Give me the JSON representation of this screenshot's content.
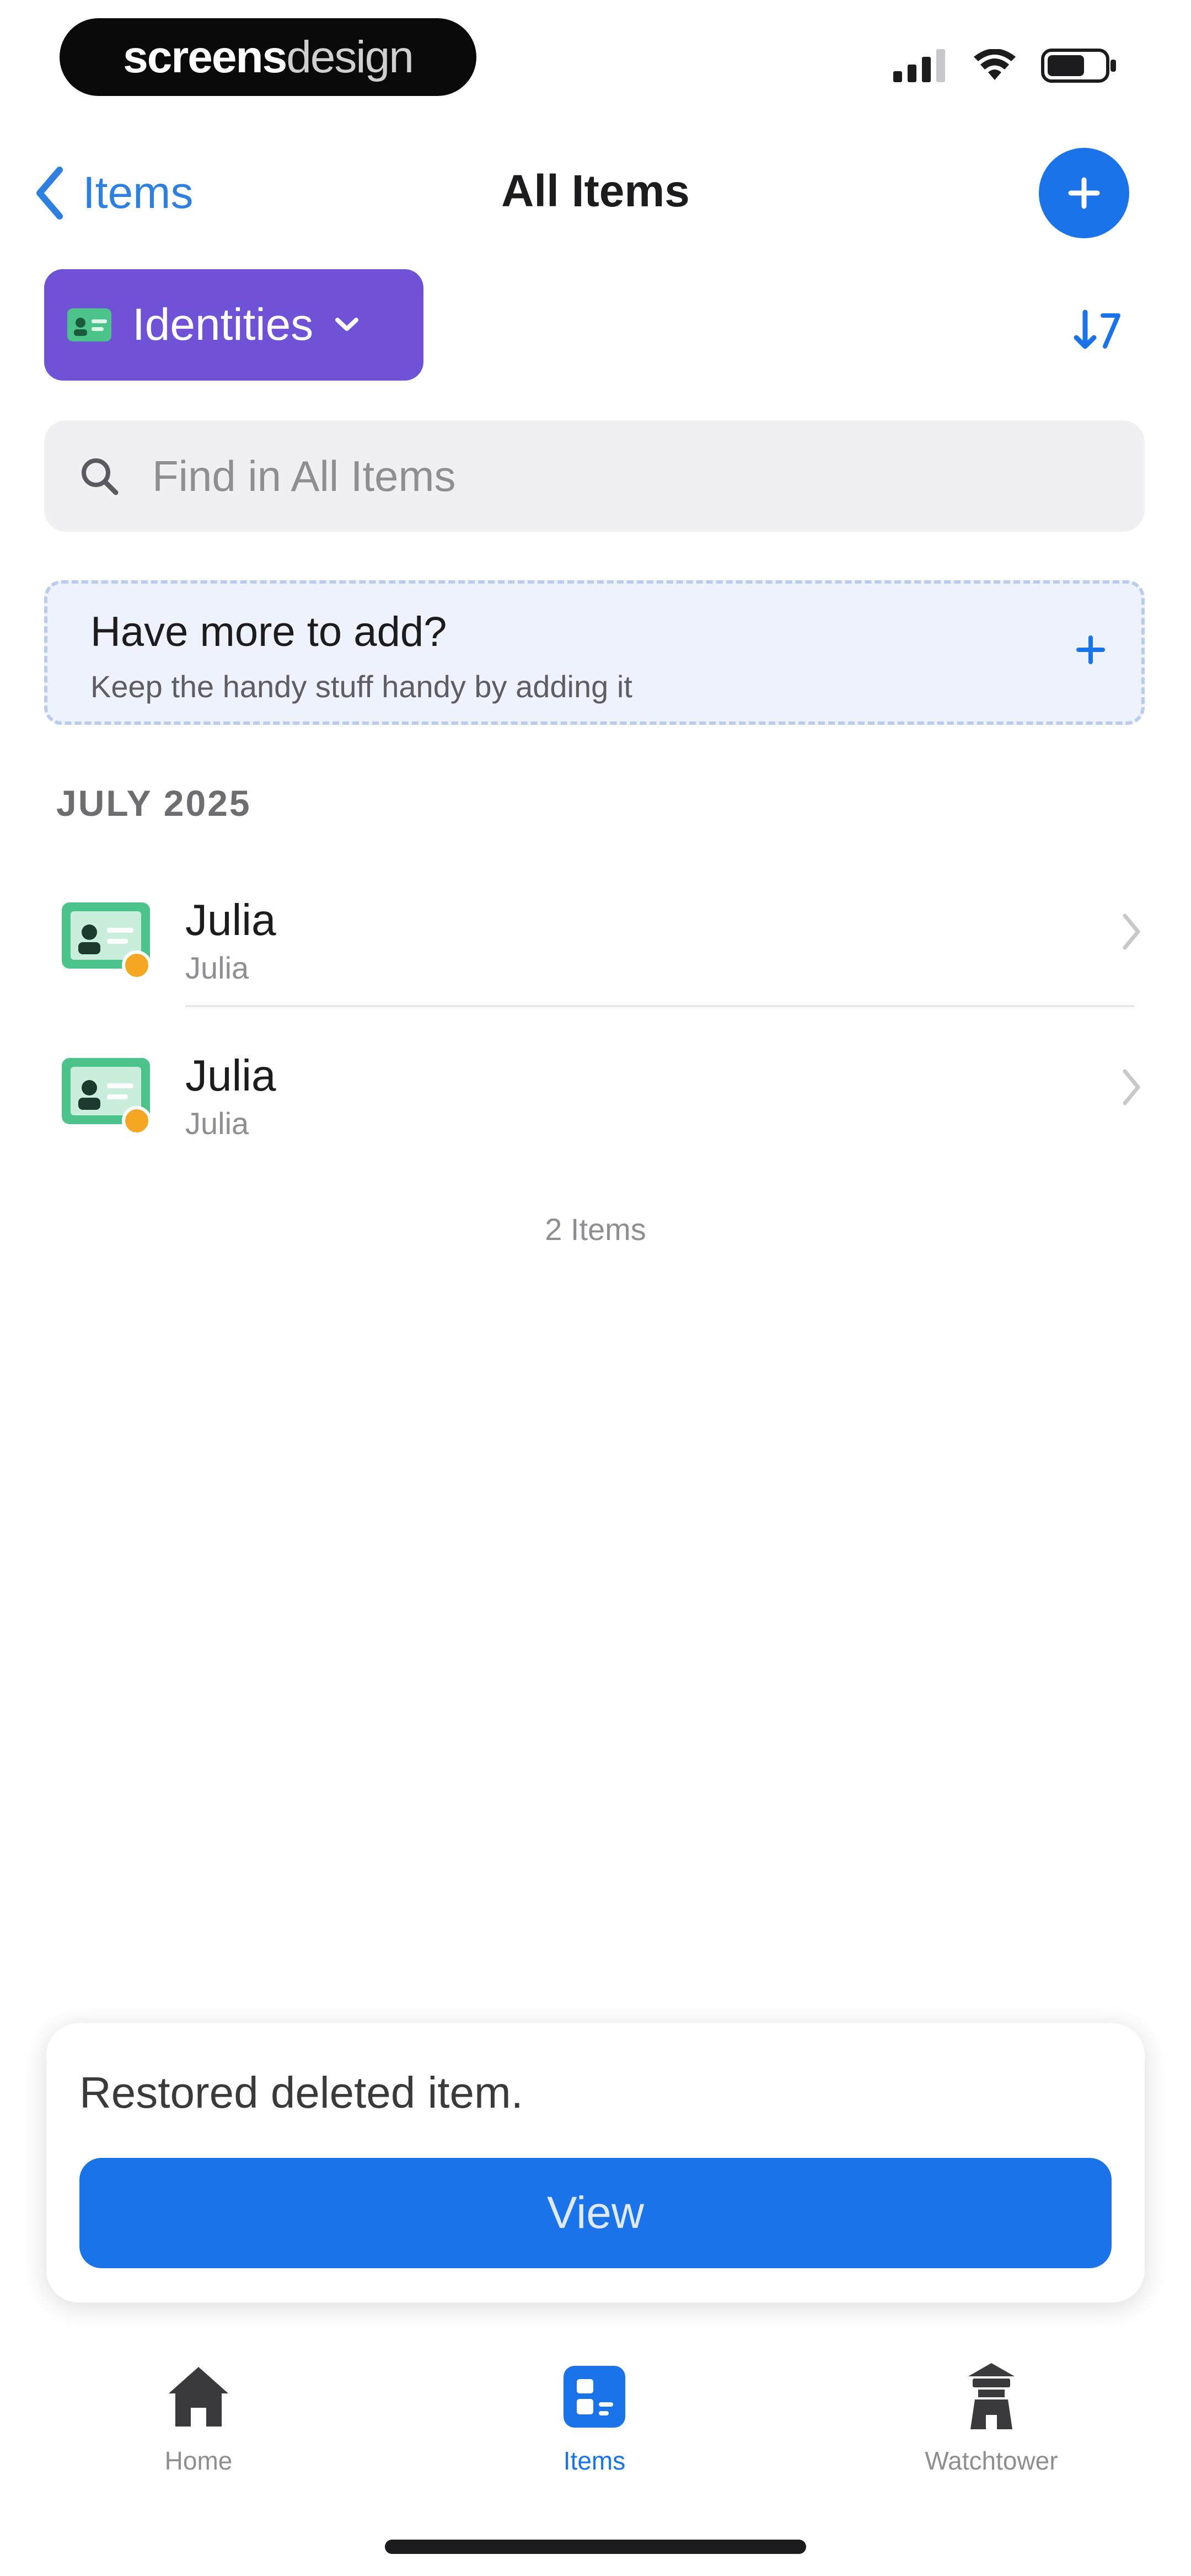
{
  "status_bar": {
    "brand_part1": "screens",
    "brand_part2": "design"
  },
  "nav": {
    "back_label": "Items",
    "title": "All Items"
  },
  "filter": {
    "label": "Identities"
  },
  "search": {
    "placeholder": "Find in All Items"
  },
  "add_more": {
    "title": "Have more to add?",
    "subtitle": "Keep the handy stuff handy by adding it"
  },
  "section": {
    "header": "JULY 2025"
  },
  "items": [
    {
      "name": "Julia",
      "subtitle": "Julia"
    },
    {
      "name": "Julia",
      "subtitle": "Julia"
    }
  ],
  "items_count": "2 Items",
  "toast": {
    "message": "Restored deleted item.",
    "button_label": "View"
  },
  "tab_bar": {
    "tabs": [
      {
        "label": "Home",
        "icon": "house-icon",
        "active": false
      },
      {
        "label": "Items",
        "icon": "items-icon",
        "active": true
      },
      {
        "label": "Watchtower",
        "icon": "watchtower-icon",
        "active": false
      }
    ]
  },
  "colors": {
    "accent": "#1a73e8",
    "filter_chip": "#7052d6",
    "identity_icon": "#4cc38a",
    "badge": "#f5a623",
    "card_bg": "#edf2fc"
  }
}
